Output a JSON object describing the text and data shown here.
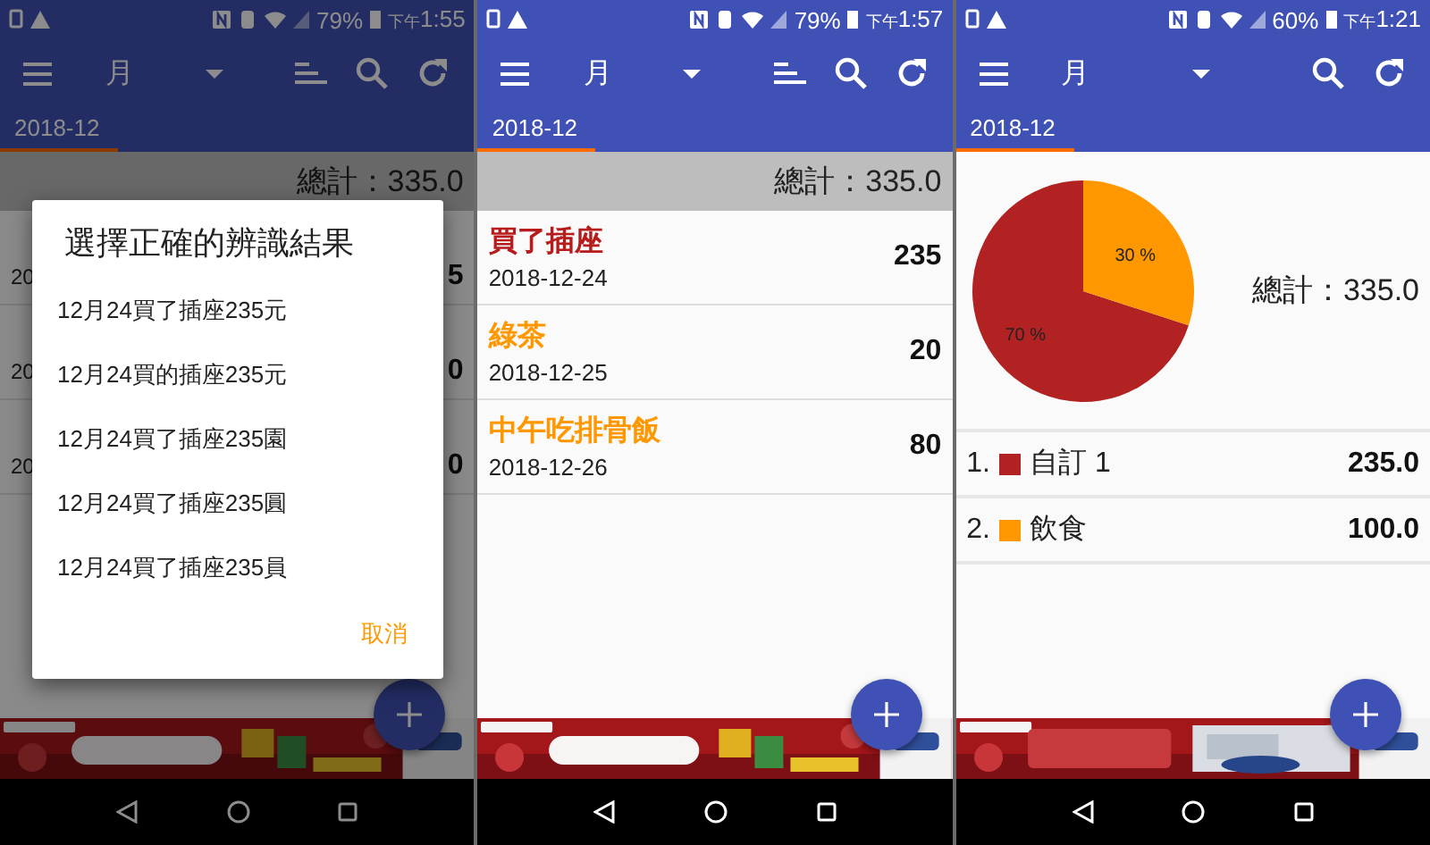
{
  "screens": [
    {
      "status_bar": {
        "battery": "79%",
        "time_period": "下午",
        "time": "1:55"
      },
      "toolbar": {
        "title": "月",
        "sort_button": true
      },
      "tabs": [
        {
          "label": "2018-12",
          "selected": true
        }
      ],
      "dimmed": true,
      "kind": "list",
      "total": "總計：335.0",
      "entries": [
        {
          "date": "20",
          "amount": "5"
        },
        {
          "date": "20",
          "amount": "0"
        },
        {
          "date": "20",
          "amount": "0"
        }
      ],
      "dialog": {
        "title": "選擇正確的辨識結果",
        "options": [
          "12月24買了插座235元",
          "12月24買的插座235元",
          "12月24買了插座235園",
          "12月24買了插座235圓",
          "12月24買了插座235員"
        ],
        "cancel": "取消"
      }
    },
    {
      "status_bar": {
        "battery": "79%",
        "time_period": "下午",
        "time": "1:57"
      },
      "toolbar": {
        "title": "月",
        "sort_button": true
      },
      "tabs": [
        {
          "label": "2018-12",
          "selected": true
        }
      ],
      "dimmed": false,
      "kind": "list",
      "total": "總計：335.0",
      "entries": [
        {
          "name": "買了插座",
          "date": "2018-12-24",
          "amount": "235",
          "color": "#b71c1c"
        },
        {
          "name": "綠茶",
          "date": "2018-12-25",
          "amount": "20",
          "color": "#ff9800"
        },
        {
          "name": "中午吃排骨飯",
          "date": "2018-12-26",
          "amount": "80",
          "color": "#ff9800"
        }
      ]
    },
    {
      "status_bar": {
        "battery": "60%",
        "time_period": "下午",
        "time": "1:21"
      },
      "toolbar": {
        "title": "月",
        "sort_button": false
      },
      "tabs": [
        {
          "label": "2018-12",
          "selected": true
        }
      ],
      "dimmed": false,
      "kind": "chart",
      "total": "總計：335.0",
      "chart_data": {
        "type": "pie",
        "values": [
          70,
          30
        ],
        "value_labels": [
          "70 %",
          "30 %"
        ]
      },
      "legend": [
        {
          "index": "1.",
          "name": "自訂 1",
          "amount": "235.0",
          "color": "#b22222"
        },
        {
          "index": "2.",
          "name": "飲食",
          "amount": "100.0",
          "color": "#ff9800"
        }
      ]
    }
  ]
}
